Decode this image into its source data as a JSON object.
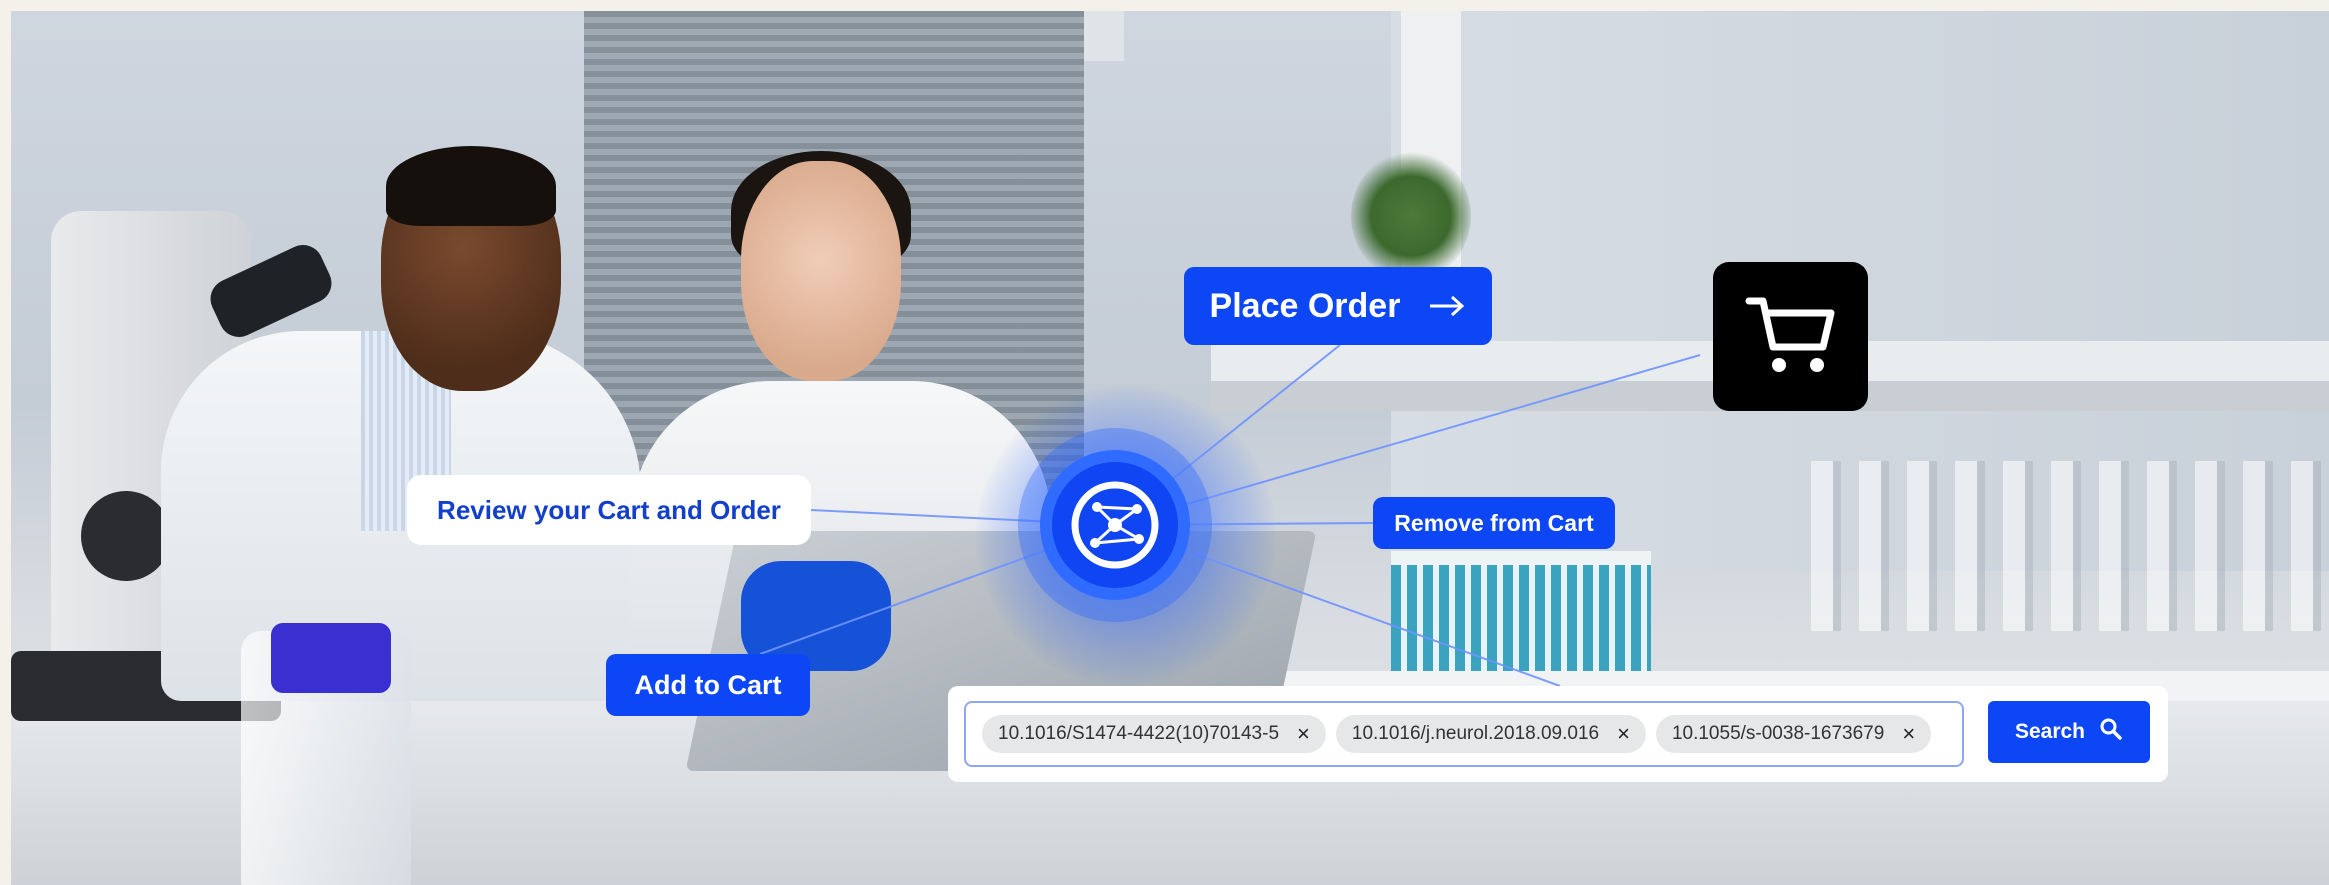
{
  "actions": {
    "place_order": "Place Order",
    "review_cart": "Review your Cart and Order",
    "remove_from_cart": "Remove from Cart",
    "add_to_cart": "Add to Cart"
  },
  "search": {
    "chips": [
      "10.1016/S1474-4422(10)70143-5",
      "10.1016/j.neurol.2018.09.016",
      "10.1055/s-0038-1673679"
    ],
    "chip_remove_glyph": "×",
    "button_label": "Search"
  },
  "icons": {
    "place_order_arrow": "arrow-right-icon",
    "cart": "shopping-cart-icon",
    "hub": "network-hub-icon",
    "search": "magnifier-icon",
    "chip_remove": "close-icon"
  },
  "colors": {
    "accent": "#0d47f5",
    "cart_tile": "#000000",
    "review_text": "#1440c9",
    "chip_bg": "#e6e7e9"
  }
}
